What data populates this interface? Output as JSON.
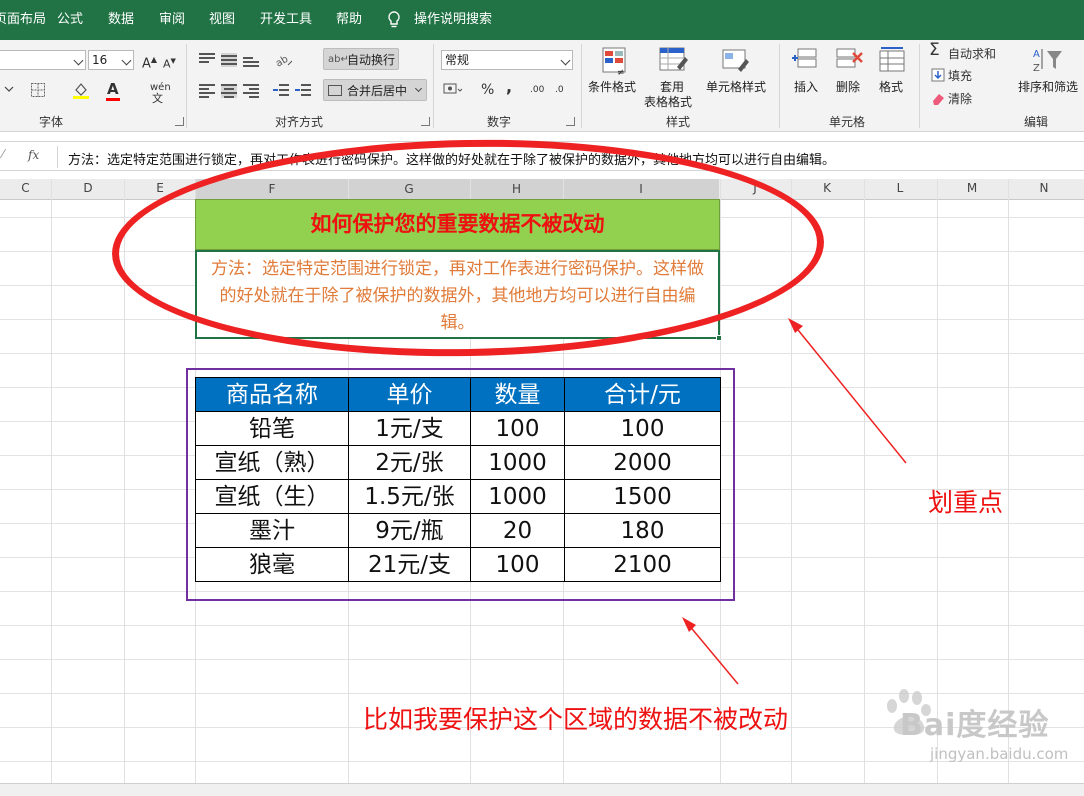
{
  "ribbon_tabs": [
    "页面布局",
    "公式",
    "数据",
    "审阅",
    "视图",
    "开发工具",
    "帮助",
    "操作说明搜索"
  ],
  "font_group": {
    "font_size": "16",
    "label": "字体",
    "grow_label": "A",
    "shrink_label": "A",
    "font_color_label": "A",
    "phonetic_label": "wén"
  },
  "alignment_group": {
    "wrap_text": "自动换行",
    "merge_center": "合并后居中",
    "label": "对齐方式"
  },
  "number_group": {
    "format": "常规",
    "percent": "%",
    "comma": ",",
    "inc_decimal": ".00",
    "dec_decimal": ".0",
    "label": "数字"
  },
  "styles_group": {
    "conditional_format": "条件格式",
    "format_as_table_1": "套用",
    "format_as_table_2": "表格格式",
    "cell_styles": "单元格样式",
    "label": "样式"
  },
  "cells_group": {
    "insert": "插入",
    "delete": "删除",
    "format": "格式",
    "label": "单元格"
  },
  "editing_group": {
    "autosum": "自动求和",
    "fill": "填充",
    "clear": "清除",
    "sort_filter": "排序和筛选",
    "label": "编辑"
  },
  "formula_bar": {
    "fx": "fx",
    "content": "方法：选定特定范围进行锁定，再对工作表进行密码保护。这样做的好处就在于除了被保护的数据外，其他地方均可以进行自由编辑。"
  },
  "columns": [
    "C",
    "D",
    "E",
    "F",
    "G",
    "H",
    "I",
    "J",
    "K",
    "L",
    "M",
    "N"
  ],
  "sheet": {
    "title": "如何保护您的重要数据不被改动",
    "description": "方法：选定特定范围进行锁定，再对工作表进行密码保护。这样做的好处就在于除了被保护的数据外，其他地方均可以进行自由编辑。",
    "table": {
      "headers": [
        "商品名称",
        "单价",
        "数量",
        "合计/元"
      ],
      "rows": [
        [
          "铅笔",
          "1元/支",
          "100",
          "100"
        ],
        [
          "宣纸（熟）",
          "2元/张",
          "1000",
          "2000"
        ],
        [
          "宣纸（生）",
          "1.5元/张",
          "1000",
          "1500"
        ],
        [
          "墨汁",
          "9元/瓶",
          "20",
          "180"
        ],
        [
          "狼毫",
          "21元/支",
          "100",
          "2100"
        ]
      ]
    }
  },
  "annotations": {
    "highlight": "划重点",
    "protect_note": "比如我要保护这个区域的数据不被改动"
  },
  "watermark": {
    "brand": "Bai度经验",
    "url": "jingyan.baidu.com"
  },
  "colors": {
    "ribbon_green": "#217346",
    "title_fill": "#92d050",
    "title_text": "#ee1111",
    "desc_text": "#e07b39",
    "header_fill": "#0070c0",
    "annotation_red": "#ee2222",
    "table_frame": "#7030a0"
  }
}
